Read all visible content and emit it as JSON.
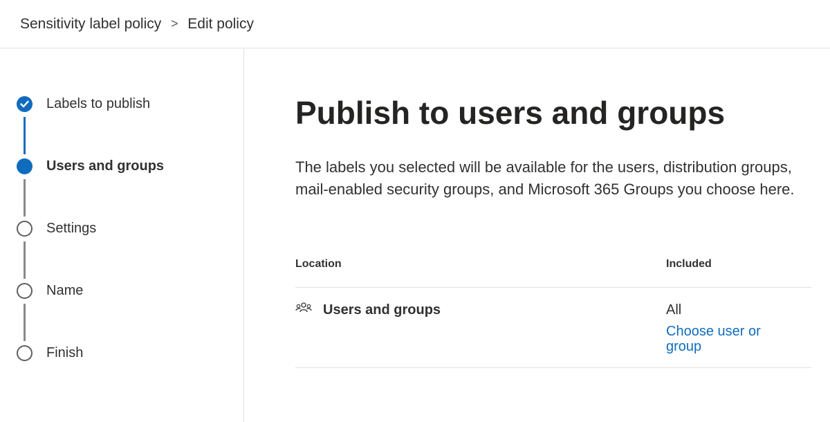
{
  "breadcrumb": {
    "parent": "Sensitivity label policy",
    "separator": ">",
    "current": "Edit policy"
  },
  "wizard": {
    "steps": [
      {
        "label": "Labels to publish",
        "state": "completed"
      },
      {
        "label": "Users and groups",
        "state": "current"
      },
      {
        "label": "Settings",
        "state": "not-started"
      },
      {
        "label": "Name",
        "state": "not-started"
      },
      {
        "label": "Finish",
        "state": "not-started"
      }
    ]
  },
  "main": {
    "title": "Publish to users and groups",
    "description": "The labels you selected will be available for the users, distribution groups, mail-enabled security groups, and Microsoft 365 Groups you choose here.",
    "table": {
      "columns": [
        "Location",
        "Included"
      ],
      "rows": [
        {
          "icon": "people-icon",
          "location": "Users and groups",
          "included": "All",
          "action": "Choose user or group"
        }
      ]
    }
  },
  "colors": {
    "accent": "#0f6cbd",
    "text": "#323130",
    "divider": "#e1dfdd"
  }
}
